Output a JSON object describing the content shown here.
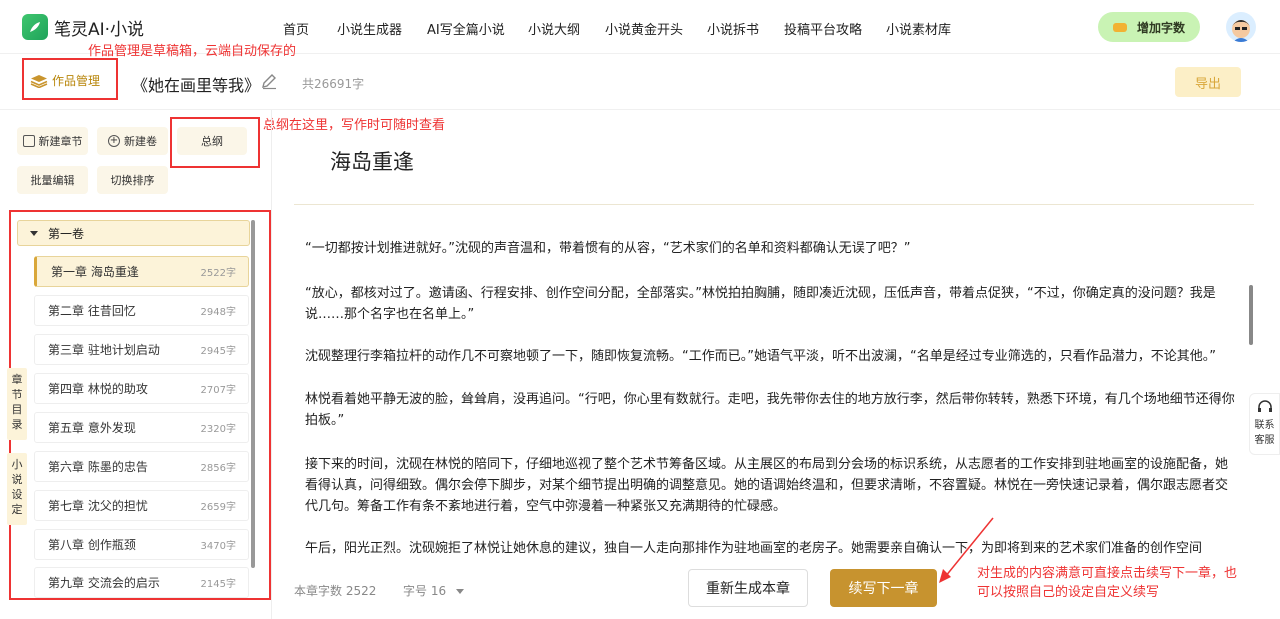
{
  "app": {
    "name": "笔灵AI·小说"
  },
  "nav": {
    "items": [
      "首页",
      "小说生成器",
      "AI写全篇小说",
      "小说大纲",
      "小说黄金开头",
      "小说拆书",
      "投稿平台攻略",
      "小说素材库"
    ]
  },
  "header": {
    "add_words": "增加字数"
  },
  "annotations": {
    "works": "作品管理是草稿箱，云端自动保存的",
    "outline": "总纲在这里，写作时可随时查看",
    "continue_1": "对生成的内容满意可直接点击续写下一章，也",
    "continue_2": "可以按照自己的设定自定义续写"
  },
  "toolbar": {
    "works_label": "作品管理",
    "book_title": "《她在画里等我》",
    "word_count": "共26691字",
    "export_label": "导出"
  },
  "sidebar": {
    "buttons": {
      "new_chapter": "新建章节",
      "new_volume": "新建卷",
      "outline": "总纲",
      "batch_edit": "批量编辑",
      "switch_sort": "切换排序"
    },
    "volume": "第一卷",
    "chapters": [
      {
        "title": "第一章 海岛重逢",
        "count": "2522字"
      },
      {
        "title": "第二章 往昔回忆",
        "count": "2948字"
      },
      {
        "title": "第三章 驻地计划启动",
        "count": "2945字"
      },
      {
        "title": "第四章 林悦的助攻",
        "count": "2707字"
      },
      {
        "title": "第五章 意外发现",
        "count": "2320字"
      },
      {
        "title": "第六章 陈墨的忠告",
        "count": "2856字"
      },
      {
        "title": "第七章 沈父的担忧",
        "count": "2659字"
      },
      {
        "title": "第八章 创作瓶颈",
        "count": "3470字"
      },
      {
        "title": "第九章 交流会的启示",
        "count": "2145字"
      }
    ],
    "tab_catalog": "章节目录",
    "tab_settings": "小说设定"
  },
  "editor": {
    "chapter_title": "海岛重逢",
    "paragraphs": [
      "“一切都按计划推进就好。”沈砚的声音温和，带着惯有的从容，“艺术家们的名单和资料都确认无误了吧？”",
      "“放心，都核对过了。邀请函、行程安排、创作空间分配，全部落实。”林悦拍拍胸脯，随即凑近沈砚，压低声音，带着点促狭，“不过，你确定真的没问题？我是说……那个名字也在名单上。”",
      "沈砚整理行李箱拉杆的动作几不可察地顿了一下，随即恢复流畅。“工作而已。”她语气平淡，听不出波澜，“名单是经过专业筛选的，只看作品潜力，不论其他。”",
      "林悦看着她平静无波的脸，耸耸肩，没再追问。“行吧，你心里有数就行。走吧，我先带你去住的地方放行李，然后带你转转，熟悉下环境，有几个场地细节还得你拍板。”",
      "接下来的时间，沈砚在林悦的陪同下，仔细地巡视了整个艺术节筹备区域。从主展区的布局到分会场的标识系统，从志愿者的工作安排到驻地画室的设施配备，她看得认真，问得细致。偶尔会停下脚步，对某个细节提出明确的调整意见。她的语调始终温和，但要求清晰，不容置疑。林悦在一旁快速记录着，偶尔跟志愿者交代几句。筹备工作有条不紊地进行着，空气中弥漫着一种紧张又充满期待的忙碌感。",
      "午后，阳光正烈。沈砚婉拒了林悦让她休息的建议，独自一人走向那排作为驻地画室的老房子。她需要亲自确认一下，为即将到来的艺术家们准备的创作空间"
    ]
  },
  "footer": {
    "chapter_words": "本章字数 2522",
    "font_size": "字号 16",
    "regen_label": "重新生成本章",
    "continue_label": "续写下一章"
  },
  "contact": {
    "label1": "联系",
    "label2": "客服"
  }
}
